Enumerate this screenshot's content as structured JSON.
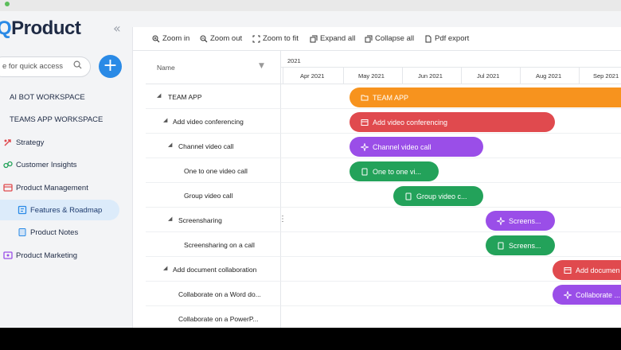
{
  "app": {
    "logo_letter": "Q",
    "logo_text": "Product",
    "collapse_glyph": "«",
    "search": {
      "placeholder": "e for quick access"
    },
    "add_glyph": "+",
    "colors": {
      "brand_blue": "#2a8ae6",
      "orange": "#f7931e",
      "red": "#e04a4e",
      "purple": "#9a4ee8",
      "green": "#23a25a",
      "active_nav_bg": "#dcebfa"
    }
  },
  "sidebar": {
    "items": [
      {
        "label": "AI BOT WORKSPACE",
        "icon": "workspace-icon"
      },
      {
        "label": "TEAMS APP WORKSPACE",
        "icon": "workspace-icon"
      },
      {
        "label": "Strategy",
        "icon": "strategy-icon"
      },
      {
        "label": "Customer Insights",
        "icon": "insights-icon"
      },
      {
        "label": "Product Management",
        "icon": "product-management-icon"
      },
      {
        "label": "Features & Roadmap",
        "icon": "roadmap-icon",
        "active": true
      },
      {
        "label": "Product Notes",
        "icon": "notes-icon"
      },
      {
        "label": "Product Marketing",
        "icon": "marketing-icon"
      }
    ]
  },
  "toolbar": {
    "zoom_in": "Zoom in",
    "zoom_out": "Zoom out",
    "zoom_fit": "Zoom to fit",
    "expand_all": "Expand all",
    "collapse_all": "Collapse all",
    "pdf_export": "Pdf export"
  },
  "grid": {
    "header": "Name",
    "sort_glyph": "▼",
    "expand_glyph": "◢",
    "rows": [
      {
        "label": "TEAM APP"
      },
      {
        "label": "Add video conferencing"
      },
      {
        "label": "Channel video call"
      },
      {
        "label": "One to one video call"
      },
      {
        "label": "Group video call"
      },
      {
        "label": "Screensharing"
      },
      {
        "label": "Screensharing on a call"
      },
      {
        "label": "Add document collaboration"
      },
      {
        "label": "Collaborate on a Word do..."
      },
      {
        "label": "Collaborate on a PowerP..."
      }
    ]
  },
  "timeline": {
    "year": "2021",
    "months": [
      "Apr 2021",
      "May 2021",
      "Jun 2021",
      "Jul 2021",
      "Aug 2021",
      "Sep 2021"
    ],
    "splitter_glyph": "⋮",
    "bars": [
      {
        "label": "TEAM APP",
        "color": "#f7931e",
        "icon": "folder-icon"
      },
      {
        "label": "Add video conferencing",
        "color": "#e04a4e",
        "icon": "feature-icon"
      },
      {
        "label": "Channel video call",
        "color": "#9a4ee8",
        "icon": "epic-icon"
      },
      {
        "label": "One to one vi...",
        "color": "#23a25a",
        "icon": "story-icon"
      },
      {
        "label": "Group video c...",
        "color": "#23a25a",
        "icon": "story-icon"
      },
      {
        "label": "Screens...",
        "color": "#9a4ee8",
        "icon": "epic-icon"
      },
      {
        "label": "Screens...",
        "color": "#23a25a",
        "icon": "story-icon"
      },
      {
        "label": "Add documen",
        "color": "#e04a4e",
        "icon": "feature-icon"
      },
      {
        "label": "Collaborate ...",
        "color": "#9a4ee8",
        "icon": "epic-icon"
      }
    ]
  }
}
